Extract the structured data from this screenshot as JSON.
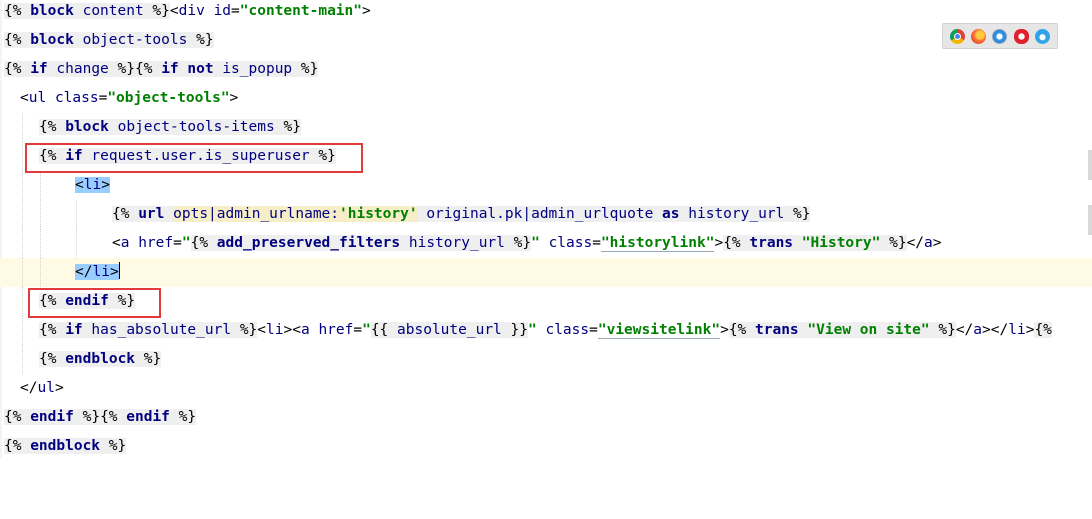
{
  "editor": {
    "lines": [
      {
        "segments": [
          {
            "t": "{% ",
            "c": "tg"
          },
          {
            "t": "block",
            "c": "tg tk"
          },
          {
            "t": " ",
            "c": "tg"
          },
          {
            "t": "content",
            "c": "tg tn"
          },
          {
            "t": " %}",
            "c": "tg"
          },
          {
            "t": "<",
            "c": ""
          },
          {
            "t": "div",
            "c": "ht"
          },
          {
            "t": " ",
            "c": ""
          },
          {
            "t": "id",
            "c": "ht"
          },
          {
            "t": "=",
            "c": ""
          },
          {
            "t": "\"content-main\"",
            "c": "st"
          },
          {
            "t": ">",
            "c": ""
          }
        ]
      },
      {
        "segments": [
          {
            "t": "{% ",
            "c": "tg"
          },
          {
            "t": "block",
            "c": "tg tk"
          },
          {
            "t": " ",
            "c": "tg"
          },
          {
            "t": "object-tools",
            "c": "tg tn"
          },
          {
            "t": " %}",
            "c": "tg"
          }
        ]
      },
      {
        "segments": [
          {
            "t": "{% ",
            "c": "tg"
          },
          {
            "t": "if",
            "c": "tg tk"
          },
          {
            "t": " ",
            "c": "tg"
          },
          {
            "t": "change",
            "c": "tg tn"
          },
          {
            "t": " %}",
            "c": "tg"
          },
          {
            "t": "{% ",
            "c": "tg"
          },
          {
            "t": "if not",
            "c": "tg tk"
          },
          {
            "t": " ",
            "c": "tg"
          },
          {
            "t": "is_popup",
            "c": "tg tn"
          },
          {
            "t": " %}",
            "c": "tg"
          }
        ]
      },
      {
        "segments": [
          {
            "t": "<",
            "c": ""
          },
          {
            "t": "ul",
            "c": "ht"
          },
          {
            "t": " ",
            "c": ""
          },
          {
            "t": "class",
            "c": "ht"
          },
          {
            "t": "=",
            "c": ""
          },
          {
            "t": "\"object-tools\"",
            "c": "st"
          },
          {
            "t": ">",
            "c": ""
          }
        ]
      },
      {
        "segments": [
          {
            "t": "{% ",
            "c": "tg"
          },
          {
            "t": "block",
            "c": "tg tk"
          },
          {
            "t": " ",
            "c": "tg"
          },
          {
            "t": "object-tools-items",
            "c": "tg tn"
          },
          {
            "t": " %}",
            "c": "tg"
          }
        ]
      },
      {
        "segments": [
          {
            "t": "{% ",
            "c": "tg"
          },
          {
            "t": "if",
            "c": "tg tk"
          },
          {
            "t": " ",
            "c": "tg"
          },
          {
            "t": "request.user.is_superuser",
            "c": "tg tn"
          },
          {
            "t": " %}",
            "c": "tg"
          }
        ]
      },
      {
        "segments": [
          {
            "t": "<",
            "c": "hl"
          },
          {
            "t": "li",
            "c": "hl ht"
          },
          {
            "t": ">",
            "c": "hl"
          }
        ]
      },
      {
        "segments": [
          {
            "t": "{% ",
            "c": "tg"
          },
          {
            "t": "url",
            "c": "tg tk"
          },
          {
            "t": " ",
            "c": "tg"
          },
          {
            "t": "opts|admin_urlname:",
            "c": "ya tn"
          },
          {
            "t": "'history'",
            "c": "ya st"
          },
          {
            "t": " ",
            "c": "tg"
          },
          {
            "t": "original.pk|admin_urlquote",
            "c": "tg tn"
          },
          {
            "t": " ",
            "c": "tg"
          },
          {
            "t": "as",
            "c": "tg tk"
          },
          {
            "t": " ",
            "c": "tg"
          },
          {
            "t": "history_url",
            "c": "tg tn"
          },
          {
            "t": " %}",
            "c": "tg"
          }
        ]
      },
      {
        "segments": [
          {
            "t": "<",
            "c": ""
          },
          {
            "t": "a",
            "c": "ht"
          },
          {
            "t": " ",
            "c": ""
          },
          {
            "t": "href",
            "c": "ht"
          },
          {
            "t": "=",
            "c": ""
          },
          {
            "t": "\"",
            "c": "st"
          },
          {
            "t": "{% ",
            "c": "tg"
          },
          {
            "t": "add_preserved_filters",
            "c": "tg tk"
          },
          {
            "t": " ",
            "c": "tg"
          },
          {
            "t": "history_url",
            "c": "tg tn"
          },
          {
            "t": " %}",
            "c": "tg"
          },
          {
            "t": "\"",
            "c": "st"
          },
          {
            "t": " ",
            "c": ""
          },
          {
            "t": "class",
            "c": "ht"
          },
          {
            "t": "=",
            "c": ""
          },
          {
            "t": "\"historylink\"",
            "c": "st"
          },
          {
            "t": ">",
            "c": ""
          },
          {
            "t": "{% ",
            "c": "tg"
          },
          {
            "t": "trans",
            "c": "tg tk"
          },
          {
            "t": " ",
            "c": "tg"
          },
          {
            "t": "\"History\"",
            "c": "tg st"
          },
          {
            "t": " %}",
            "c": "tg"
          },
          {
            "t": "</",
            "c": ""
          },
          {
            "t": "a",
            "c": "ht"
          },
          {
            "t": ">",
            "c": ""
          }
        ]
      },
      {
        "segments": [
          {
            "t": "</",
            "c": "hl"
          },
          {
            "t": "li",
            "c": "hl ht"
          },
          {
            "t": ">",
            "c": "hl"
          }
        ]
      },
      {
        "segments": [
          {
            "t": "{% ",
            "c": "tg"
          },
          {
            "t": "endif",
            "c": "tg tk"
          },
          {
            "t": " %}",
            "c": "tg"
          }
        ]
      },
      {
        "segments": [
          {
            "t": "{% ",
            "c": "tg"
          },
          {
            "t": "if",
            "c": "tg tk"
          },
          {
            "t": " ",
            "c": "tg"
          },
          {
            "t": "has_absolute_url",
            "c": "tg tn"
          },
          {
            "t": " %}",
            "c": "tg"
          },
          {
            "t": "<",
            "c": ""
          },
          {
            "t": "li",
            "c": "ht"
          },
          {
            "t": "><",
            "c": ""
          },
          {
            "t": "a",
            "c": "ht"
          },
          {
            "t": " ",
            "c": ""
          },
          {
            "t": "href",
            "c": "ht"
          },
          {
            "t": "=",
            "c": ""
          },
          {
            "t": "\"",
            "c": "st"
          },
          {
            "t": "{{ ",
            "c": "tg"
          },
          {
            "t": "absolute_url",
            "c": "tg tn"
          },
          {
            "t": " }}",
            "c": "tg"
          },
          {
            "t": "\"",
            "c": "st"
          },
          {
            "t": " ",
            "c": ""
          },
          {
            "t": "class",
            "c": "ht"
          },
          {
            "t": "=",
            "c": ""
          },
          {
            "t": "\"viewsitelink\"",
            "c": "st"
          },
          {
            "t": ">",
            "c": ""
          },
          {
            "t": "{% ",
            "c": "tg"
          },
          {
            "t": "trans",
            "c": "tg tk"
          },
          {
            "t": " ",
            "c": "tg"
          },
          {
            "t": "\"View on site\"",
            "c": "tg st"
          },
          {
            "t": " %}",
            "c": "tg"
          },
          {
            "t": "</",
            "c": ""
          },
          {
            "t": "a",
            "c": "ht"
          },
          {
            "t": "></",
            "c": ""
          },
          {
            "t": "li",
            "c": "ht"
          },
          {
            "t": ">",
            "c": ""
          },
          {
            "t": "{%",
            "c": "tg"
          }
        ]
      },
      {
        "segments": [
          {
            "t": "{% ",
            "c": "tg"
          },
          {
            "t": "endblock",
            "c": "tg tk"
          },
          {
            "t": " %}",
            "c": "tg"
          }
        ]
      },
      {
        "segments": [
          {
            "t": "</",
            "c": ""
          },
          {
            "t": "ul",
            "c": "ht"
          },
          {
            "t": ">",
            "c": ""
          }
        ]
      },
      {
        "segments": [
          {
            "t": "{% ",
            "c": "tg"
          },
          {
            "t": "endif",
            "c": "tg tk"
          },
          {
            "t": " %}",
            "c": "tg"
          },
          {
            "t": "{% ",
            "c": "tg"
          },
          {
            "t": "endif",
            "c": "tg tk"
          },
          {
            "t": " %}",
            "c": "tg"
          }
        ]
      },
      {
        "segments": [
          {
            "t": "{% ",
            "c": "tg"
          },
          {
            "t": "endblock",
            "c": "tg tk"
          },
          {
            "t": " %}",
            "c": "tg"
          }
        ]
      }
    ]
  },
  "browser_preview": {
    "icons": [
      "chrome-icon",
      "firefox-icon",
      "safari-icon",
      "opera-icon",
      "ie-icon"
    ]
  },
  "annotations": {
    "box_color": "#e23b3b"
  }
}
